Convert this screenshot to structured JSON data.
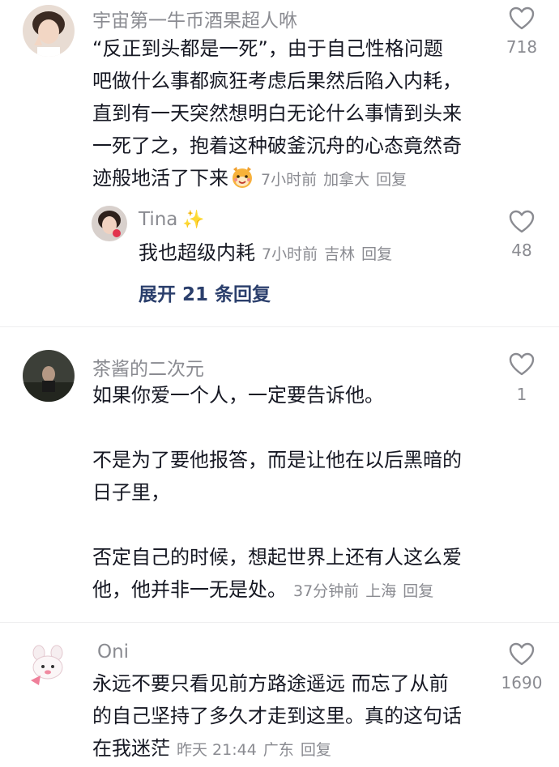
{
  "comments": [
    {
      "username": "宇宙第一牛币酒果超人咻",
      "text": "“反正到头都是一死”，由于自己性格问题\n吧做什么事都疯狂考虑后果然后陷入内耗，\n直到有一天突然想明白无论什么事情到头来\n一死了之，抱着这种破釜沉舟的心态竟然奇\n迹般地活了下来",
      "time": "7小时前",
      "location": "加拿大",
      "reply_label": "回复",
      "likes": "718",
      "emoji": "smiling-fox-emoji"
    },
    {
      "username": "Tina",
      "sparkle": "✨",
      "text": "我也超级内耗",
      "time": "7小时前",
      "location": "吉林",
      "reply_label": "回复",
      "likes": "48"
    },
    {
      "username": "茶酱的二次元",
      "text": "如果你爱一个人，一定要告诉他。\n\n不是为了要他报答，而是让他在以后黑暗的\n日子里，\n\n否定自己的时候，想起世界上还有人这么爱\n他，他并非一无是处。",
      "time": "37分钟前",
      "location": "上海",
      "reply_label": "回复",
      "likes": "1"
    },
    {
      "username": "Oni",
      "text": "永远不要只看见前方路途遥远 而忘了从前\n的自己坚持了多久才走到这里。真的这句话\n在我迷茫",
      "time": "昨天 21:44",
      "location": "广东",
      "reply_label": "回复",
      "likes": "1690"
    }
  ],
  "expand_replies": "展开 21 条回复",
  "colors": {
    "text": "#161823",
    "meta": "#8a8b91",
    "link": "#2b3f6c",
    "heart": "#8a8b91",
    "divider": "#efeff0"
  },
  "icons": {
    "like": "heart-outline-icon"
  }
}
